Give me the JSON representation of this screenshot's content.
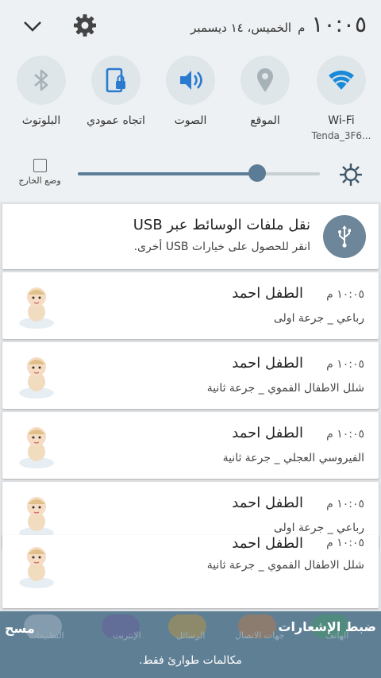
{
  "status": {
    "time": "١٠:٠٥",
    "ampm": "م",
    "date": "الخميس، ١٤ ديسمبر"
  },
  "toggles": [
    {
      "label": "البلوتوث",
      "icon": "bluetooth-icon"
    },
    {
      "label": "اتجاه عمودي",
      "icon": "portrait-lock-icon"
    },
    {
      "label": "الصوت",
      "icon": "sound-icon"
    },
    {
      "label": "الموقع",
      "icon": "location-icon"
    },
    {
      "label": "Wi-Fi",
      "sub": "Tenda_3F6...",
      "icon": "wifi-icon"
    }
  ],
  "brightness": {
    "outdoor_label": "وضع الخارج",
    "level": 0.74
  },
  "usb": {
    "title": "نقل ملفات الوسائط عبر USB",
    "text": "انقر للحصول على خيارات USB أخرى."
  },
  "notifications": [
    {
      "sender": "الطفل احمد",
      "time": "١٠:٠٥ م",
      "body": "رباعي _ جرعة اولى"
    },
    {
      "sender": "الطفل احمد",
      "time": "١٠:٠٥ م",
      "body": "شلل الاطفال الفموي _ جرعة ثانية"
    },
    {
      "sender": "الطفل احمد",
      "time": "١٠:٠٥ م",
      "body": "الفيروسي العجلي _ جرعة ثانية"
    },
    {
      "sender": "الطفل احمد",
      "time": "١٠:٠٥ م",
      "body": "رباعي _ جرعة اولى"
    },
    {
      "sender": "الطفل احمد",
      "time": "١٠:٠٥ م",
      "body": "شلل الاطفال الفموي _ جرعة ثانية"
    }
  ],
  "bottom": {
    "clear": "مسح",
    "settings": "ضبط الإشعارات",
    "emergency": "مكالمات طوارئ فقط.",
    "dock_labels": [
      "التطبيقات",
      "الإنترنت",
      "الرسائل",
      "جهات الاتصال",
      "الهاتف"
    ]
  },
  "colors": {
    "accent": "#5b7c96",
    "wifi_blue": "#1a8ad8",
    "icon_blue": "#2a7bd0",
    "bottom_bg": "#5f7f95"
  }
}
